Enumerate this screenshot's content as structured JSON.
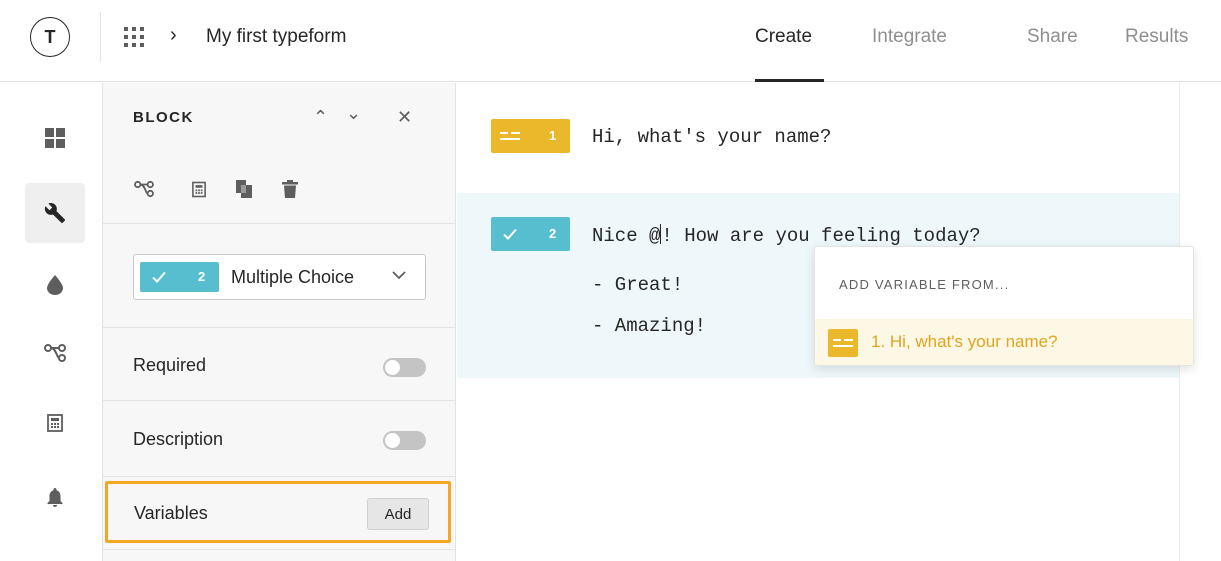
{
  "header": {
    "logo_letter": "T",
    "breadcrumb_title": "My first typeform",
    "tabs": [
      {
        "label": "Create",
        "active": true
      },
      {
        "label": "Integrate",
        "active": false
      },
      {
        "label": "Share",
        "active": false
      },
      {
        "label": "Results",
        "active": false
      }
    ]
  },
  "rail": {
    "items": [
      "layout-grid-icon",
      "wrench-icon",
      "drop-icon",
      "logic-jump-icon",
      "calculator-icon",
      "bell-icon"
    ],
    "active": "wrench-icon"
  },
  "panel": {
    "title": "BLOCK",
    "tools": [
      "logic-jump-icon",
      "calculator-icon",
      "duplicate-icon",
      "trash-icon"
    ],
    "question_type": {
      "number": "2",
      "label": "Multiple Choice"
    },
    "required_label": "Required",
    "description_label": "Description",
    "variables_label": "Variables",
    "add_label": "Add"
  },
  "canvas": {
    "questions": [
      {
        "number": "1",
        "type": "short-text",
        "text": "Hi, what's your name?"
      },
      {
        "number": "2",
        "type": "multiple-choice",
        "text_before": "Nice @",
        "text_after": "! How are you feeling today?",
        "choices": [
          "- Great!",
          "- Amazing!"
        ]
      }
    ]
  },
  "dropdown": {
    "heading": "ADD VARIABLE FROM...",
    "item_label": "1. Hi, what's your name?"
  },
  "colors": {
    "short_text_yellow": "#ebb82c",
    "multiple_choice_teal": "#57bed0",
    "highlight_orange": "#f5a623"
  }
}
